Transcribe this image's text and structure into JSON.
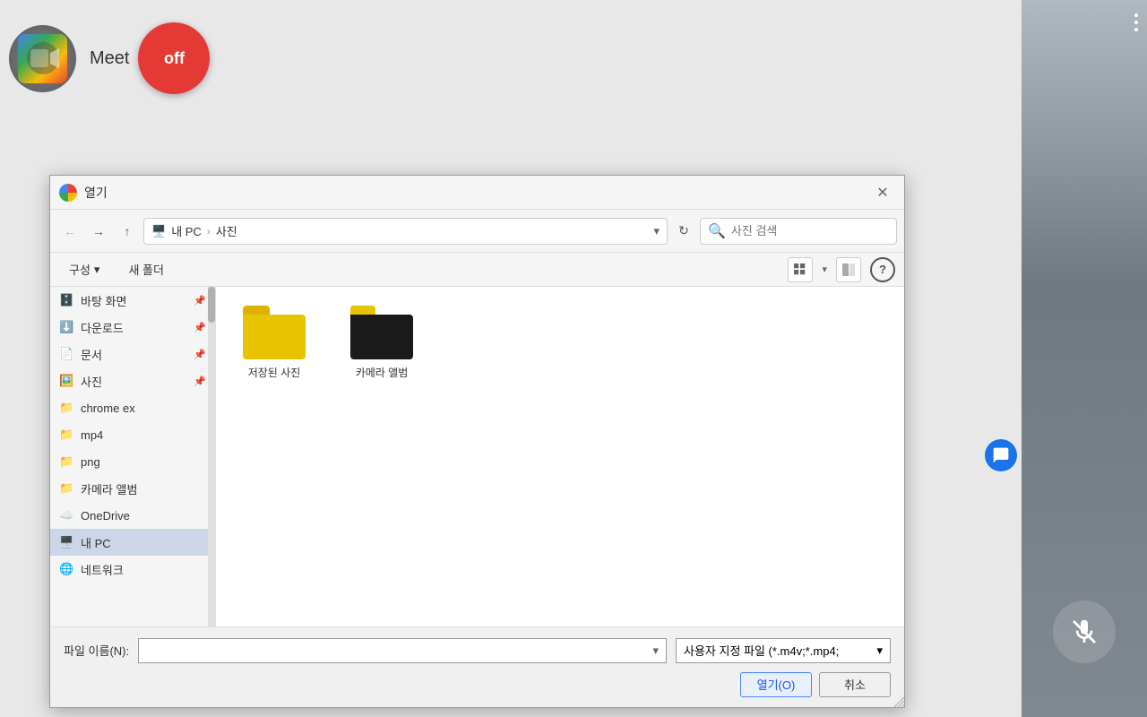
{
  "top": {
    "meet_label": "Meet",
    "off_label": "off"
  },
  "dialog": {
    "title": "열기",
    "close_label": "✕",
    "address": {
      "home": "⌂",
      "path_parts": [
        "내 PC",
        "사진"
      ],
      "search_placeholder": "사진 검색"
    },
    "toolbar": {
      "organize_label": "구성",
      "new_folder_label": "새 폴더",
      "help_label": "?"
    },
    "sidebar": {
      "items": [
        {
          "id": "desktop",
          "label": "바탕 화면",
          "icon": "folder-blue",
          "pinned": true
        },
        {
          "id": "downloads",
          "label": "다운로드",
          "icon": "folder-download",
          "pinned": true
        },
        {
          "id": "documents",
          "label": "문서",
          "icon": "folder-doc",
          "pinned": true
        },
        {
          "id": "photos",
          "label": "사진",
          "icon": "folder-photo",
          "pinned": true
        },
        {
          "id": "chrome-ex",
          "label": "chrome ex",
          "icon": "folder-yellow"
        },
        {
          "id": "mp4",
          "label": "mp4",
          "icon": "folder-yellow"
        },
        {
          "id": "png",
          "label": "png",
          "icon": "folder-yellow"
        },
        {
          "id": "camera-album-side",
          "label": "카메라 앨범",
          "icon": "folder-yellow"
        },
        {
          "id": "onedrive",
          "label": "OneDrive",
          "icon": "onedrive"
        },
        {
          "id": "my-pc",
          "label": "내 PC",
          "icon": "my-pc",
          "selected": true
        },
        {
          "id": "network",
          "label": "네트워크",
          "icon": "network"
        }
      ]
    },
    "files": [
      {
        "id": "saved-photos",
        "name": "저장된 사진",
        "type": "folder-yellow"
      },
      {
        "id": "camera-album",
        "name": "카메라 앨범",
        "type": "folder-dark"
      }
    ],
    "bottom": {
      "filename_label": "파일 이름(N):",
      "filename_value": "",
      "filetype_label": "사용자 지정 파일 (*.m4v;*.mp4;",
      "open_label": "열기(O)",
      "cancel_label": "취소"
    }
  },
  "right_panel": {
    "menu_dots": "⋮"
  }
}
